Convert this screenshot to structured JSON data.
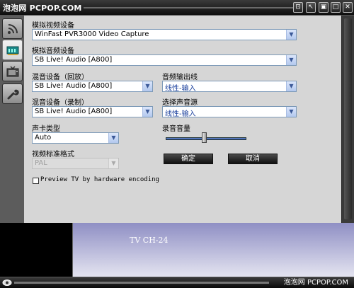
{
  "titlebar": {
    "title": "泡泡网 PCPOP.COM",
    "buttons": [
      "⊡",
      "↖",
      "▣",
      "□",
      "✕"
    ]
  },
  "sidebar": {
    "tabs": [
      "signal-tab",
      "audio-tab",
      "tv-tab",
      "settings-tab"
    ],
    "active": "audio-tab"
  },
  "form": {
    "video_device_label": "模拟视频设备",
    "video_device_value": "WinFast PVR3000 Video Capture",
    "audio_device_label": "模拟音频设备",
    "audio_device_value": "SB Live! Audio [A800]",
    "mixer_playback_label": "混音设备（回放）",
    "mixer_playback_value": "SB Live! Audio [A800]",
    "audio_output_label": "音频输出线",
    "audio_output_value": "线性-输入",
    "mixer_record_label": "混音设备（录制）",
    "mixer_record_value": "SB Live! Audio [A800]",
    "audio_source_label": "选择声音源",
    "audio_source_value": "线性-输入",
    "sound_card_type_label": "声卡类型",
    "sound_card_type_value": "Auto",
    "record_volume_label": "录音音量",
    "record_volume_level": 0.47,
    "video_standard_label": "视频标准格式",
    "video_standard_value": "PAL",
    "ok_label": "确定",
    "cancel_label": "取消",
    "preview_checkbox_label": "Preview TV by hardware encoding",
    "preview_checked": false
  },
  "video": {
    "channel_text": "TV CH-24",
    "watermark": "泡泡网 PCPOP.COM"
  },
  "colors": {
    "panel": "#d6d6d6",
    "chrome": "#1a1a1a",
    "combo_arrow": "#b3c8ee",
    "blue_text": "#1a3f9c"
  }
}
